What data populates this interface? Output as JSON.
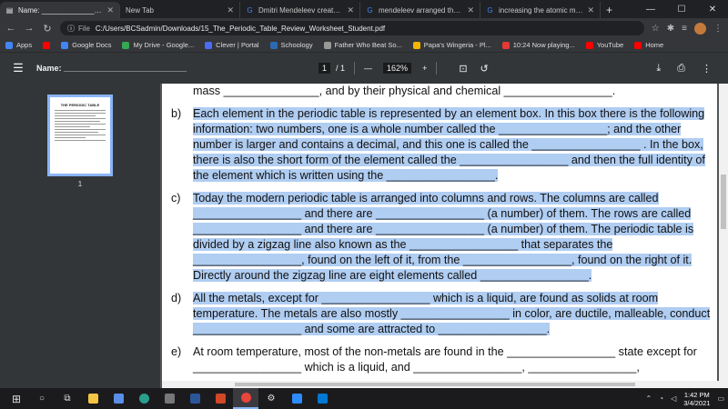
{
  "browser": {
    "tabs": [
      {
        "label": "Name: ___________________",
        "active": true
      },
      {
        "label": "New Tab",
        "active": false
      },
      {
        "label": "Dmitri Mendeleev created a ch",
        "active": false
      },
      {
        "label": "mendeleev arranged the elem",
        "active": false
      },
      {
        "label": "increasing the atomic mass b",
        "active": false
      }
    ],
    "address": {
      "label": "File",
      "url": "C:/Users/BCSadmin/Downloads/15_The_Periodic_Table_Review_Worksheet_Student.pdf"
    },
    "bookmarks": [
      {
        "label": "Apps",
        "color": "#4285f4"
      },
      {
        "label": "",
        "color": "#ff0000"
      },
      {
        "label": "Google Docs",
        "color": "#4285f4"
      },
      {
        "label": "My Drive - Google...",
        "color": "#34a853"
      },
      {
        "label": "Clever | Portal",
        "color": "#4a6cf7"
      },
      {
        "label": "Schoology",
        "color": "#2a6bb5"
      },
      {
        "label": "Father Who Beat So...",
        "color": "#999999"
      },
      {
        "label": "Papa's Wingeria - Pl...",
        "color": "#f4b400"
      },
      {
        "label": "10:24 Now playing...",
        "color": "#e53935"
      },
      {
        "label": "YouTube",
        "color": "#ff0000"
      },
      {
        "label": "Home",
        "color": "#ff0000"
      }
    ]
  },
  "pdf": {
    "title": "Name: ___________________________",
    "page_current": "1",
    "page_total": "/ 1",
    "zoom": "162%",
    "thumbnail_title": "THE PERIODIC TABLE",
    "thumbnail_page": "1"
  },
  "document": {
    "intro": "mass _______________, and by their physical and chemical _________________.",
    "items": [
      {
        "label": "b)",
        "highlight": true,
        "text": "Each element in the periodic table is represented by an element box. In this box there is the following information: two numbers, one is a whole number called the _________________; and the other number is larger and contains a decimal, and this one is called the _________________ . In the box, there is also the short form of the element called the _________________ and then the full identity of the element which is written using the _________________."
      },
      {
        "label": "c)",
        "highlight": true,
        "text": "Today the modern periodic table is arranged into columns and rows. The columns are called _________________ and there are _________________ (a number) of them. The rows are called _________________ and there are _________________ (a number) of them. The periodic table is divided by a zigzag line also known as the _________________ that separates the _________________, found on the left of it, from the _________________, found on the right of it. Directly around the zigzag line are eight elements called _________________."
      },
      {
        "label": "d)",
        "highlight": true,
        "text": "All the metals, except for _________________ which is a liquid, are found as solids at room temperature. The metals are also mostly _________________ in color, are ductile, malleable, conduct _________________ and some are attracted to _________________."
      },
      {
        "label": "e)",
        "highlight": false,
        "text": "At room temperature, most of the non-metals are found in the _________________ state except for _________________ which is a liquid, and _________________, _________________,"
      }
    ]
  },
  "taskbar": {
    "time": "1:42 PM",
    "date": "3/4/2021"
  }
}
